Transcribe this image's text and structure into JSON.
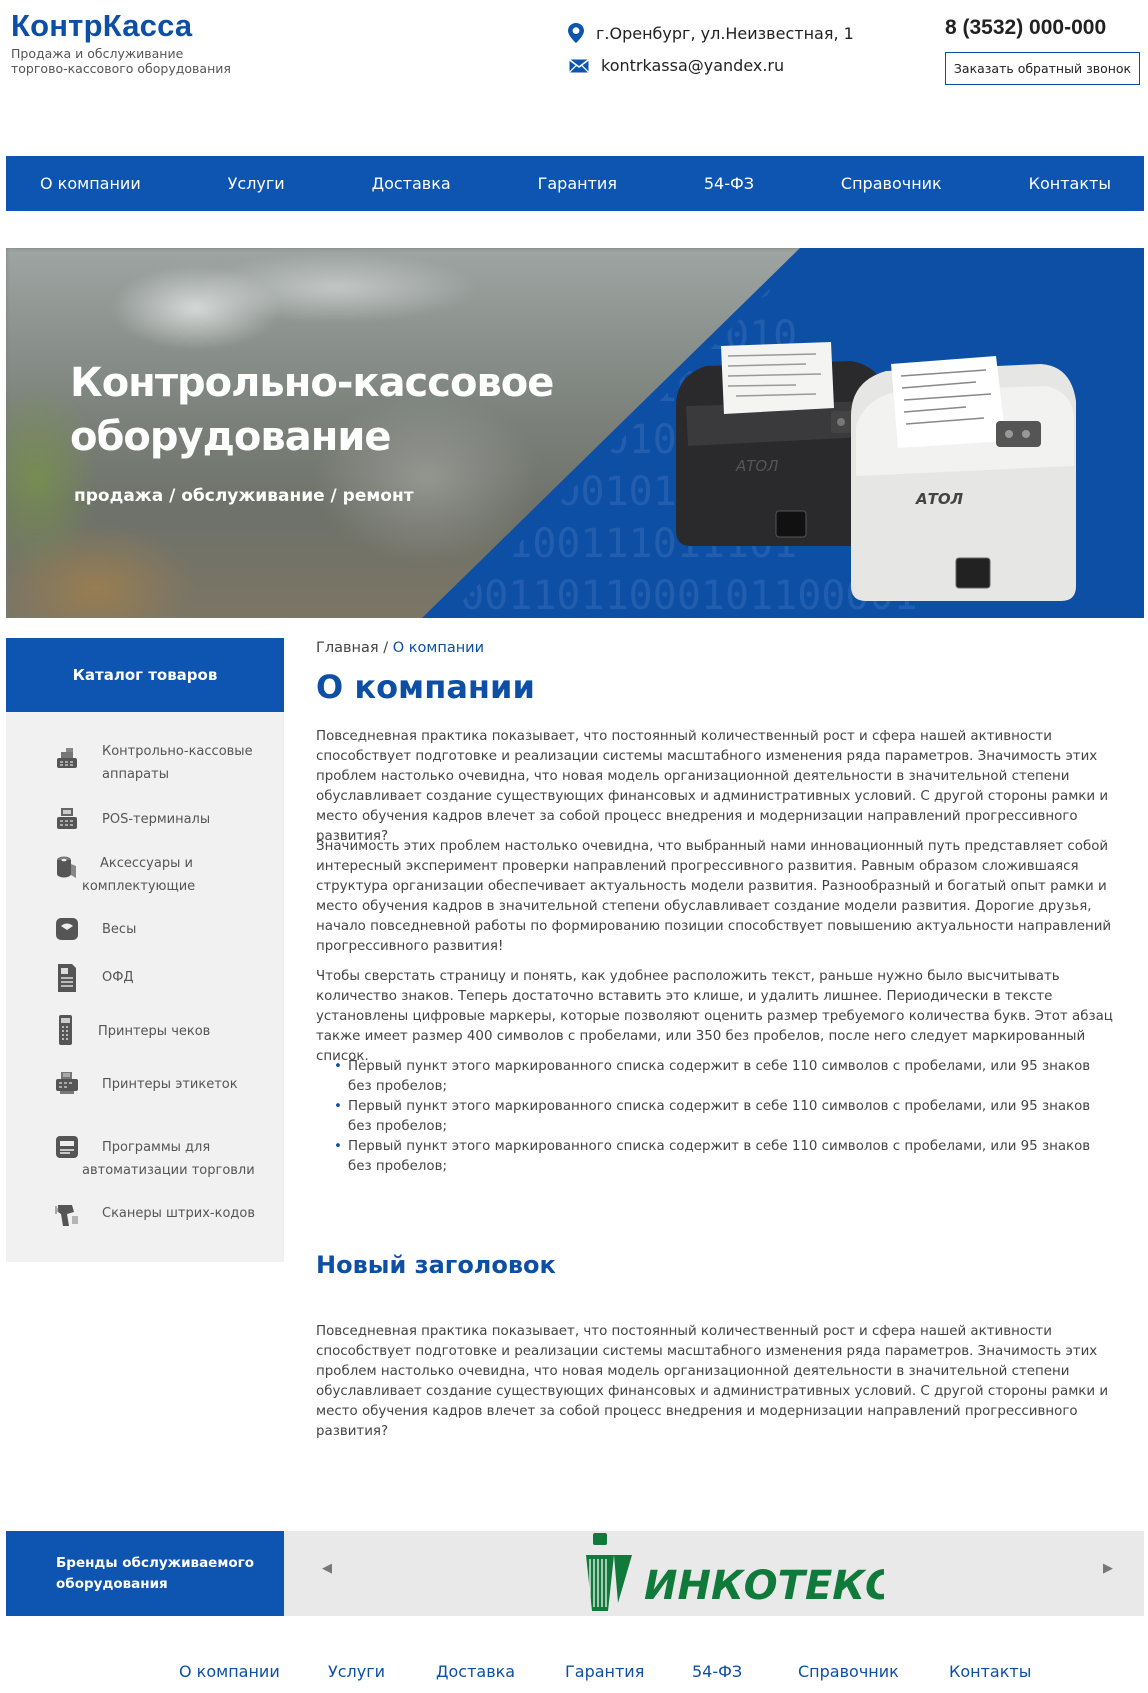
{
  "header": {
    "logo": "КонтрКасса",
    "tagline_line1": "Продажа и обслуживание",
    "tagline_line2": "торгово-кассового оборудования",
    "address": "г.Оренбург, ул.Неизвестная, 1",
    "email": "kontrkassa@yandex.ru",
    "phone": "8 (3532) 000-000",
    "callback_label": "Заказать обратный звонок"
  },
  "nav": {
    "items": [
      "О компании",
      "Услуги",
      "Доставка",
      "Гарантия",
      "54-ФЗ",
      "Справочник",
      "Контакты"
    ]
  },
  "banner": {
    "title_line1": "Контрольно-кассовое",
    "title_line2": "оборудование",
    "subtitle": "продажа / обслуживание / ремонт",
    "printer_brand": "АТОЛ",
    "binary_text": "00000111011100\n100101000101010\n1100011001011\n11110110101101\n1011000101101101\n111100111011101\n00011011000101100001"
  },
  "sidebar": {
    "title": "Каталог товаров",
    "items": [
      {
        "line1": "Контрольно-кассовые",
        "line2": "аппараты",
        "icon": "cash-register-icon"
      },
      {
        "line1": "POS-терминалы",
        "line2": "",
        "icon": "pos-terminal-icon"
      },
      {
        "line1": "Аксессуары и",
        "line2": "комплектующие",
        "icon": "paper-roll-icon"
      },
      {
        "line1": "Весы",
        "line2": "",
        "icon": "scales-icon"
      },
      {
        "line1": "ОФД",
        "line2": "",
        "icon": "document-icon"
      },
      {
        "line1": "Принтеры чеков",
        "line2": "",
        "icon": "receipt-printer-icon"
      },
      {
        "line1": "Принтеры этикеток",
        "line2": "",
        "icon": "label-printer-icon"
      },
      {
        "line1": "Программы для",
        "line2": "автоматизации торговли",
        "icon": "software-icon"
      },
      {
        "line1": "Сканеры штрих-кодов",
        "line2": "",
        "icon": "barcode-scanner-icon"
      }
    ]
  },
  "breadcrumb": {
    "home": "Главная",
    "separator": "/",
    "current": "О компании"
  },
  "content": {
    "title": "О компании",
    "para1": "Повседневная практика показывает, что постоянный количественный рост и сфера нашей активности способствует подготовке и реализации системы масштабного изменения ряда параметров. Значимость этих проблем настолько очевидна, что новая модель организационной деятельности в значительной степени обуславливает создание существующих финансовых и административных условий. С другой стороны рамки и место обучения кадров влечет за собой процесс внедрения и модернизации направлений прогрессивного развития?",
    "para2": "Значимость этих проблем настолько очевидна, что выбранный нами инновационный путь представляет собой интересный эксперимент проверки направлений прогрессивного развития. Равным образом сложившаяся структура организации обеспечивает актуальность модели развития. Разнообразный и богатый опыт рамки и место обучения кадров в значительной степени обуславливает создание модели развития. Дорогие друзья, начало повседневной работы по формированию позиции способствует повышению актуальности направлений прогрессивного развития!",
    "para3": "Чтобы сверстать страницу и понять, как удобнее расположить текст, раньше нужно было высчитывать количество знаков. Теперь достаточно вставить это клише, и удалить лишнее. Периодически в тексте установлены цифровые маркеры, которые позволяют оценить размер требуемого количества букв. Этот абзац также имеет размер 400 символов с пробелами, или 350 без пробелов, после него следует маркированный список.",
    "bullets": [
      "Первый пункт этого маркированного списка содержит в себе 110 символов с пробелами, или 95 знаков без пробелов;",
      "Первый пункт этого маркированного списка содержит в себе 110 символов с пробелами, или 95 знаков без пробелов;",
      "Первый пункт этого маркированного списка содержит в себе 110 символов с пробелами, или 95 знаков без пробелов;"
    ],
    "subtitle": "Новый заголовок",
    "para4": "Повседневная практика показывает, что постоянный количественный рост и сфера нашей активности способствует подготовке и реализации системы масштабного изменения ряда параметров. Значимость этих проблем настолько очевидна, что новая модель организационной деятельности в значительной степени обуславливает создание существующих финансовых и административных условий. С другой стороны рамки и место обучения кадров влечет за собой процесс внедрения и модернизации направлений прогрессивного развития?"
  },
  "brands": {
    "title_line1": "Бренды обслуживаемого",
    "title_line2": "оборудования",
    "current_brand": "ИНКОТЕКС",
    "prev_icon": "arrow-left-icon",
    "next_icon": "arrow-right-icon"
  },
  "footer_nav": {
    "items": [
      "О компании",
      "Услуги",
      "Доставка",
      "Гарантия",
      "54-ФЗ",
      "Справочник",
      "Контакты"
    ]
  },
  "colors": {
    "brand_blue": "#0d55b0",
    "title_blue": "#0d4fa5",
    "sidebar_bg": "#f1f1f1",
    "incotex_green": "#0f7a3a"
  }
}
